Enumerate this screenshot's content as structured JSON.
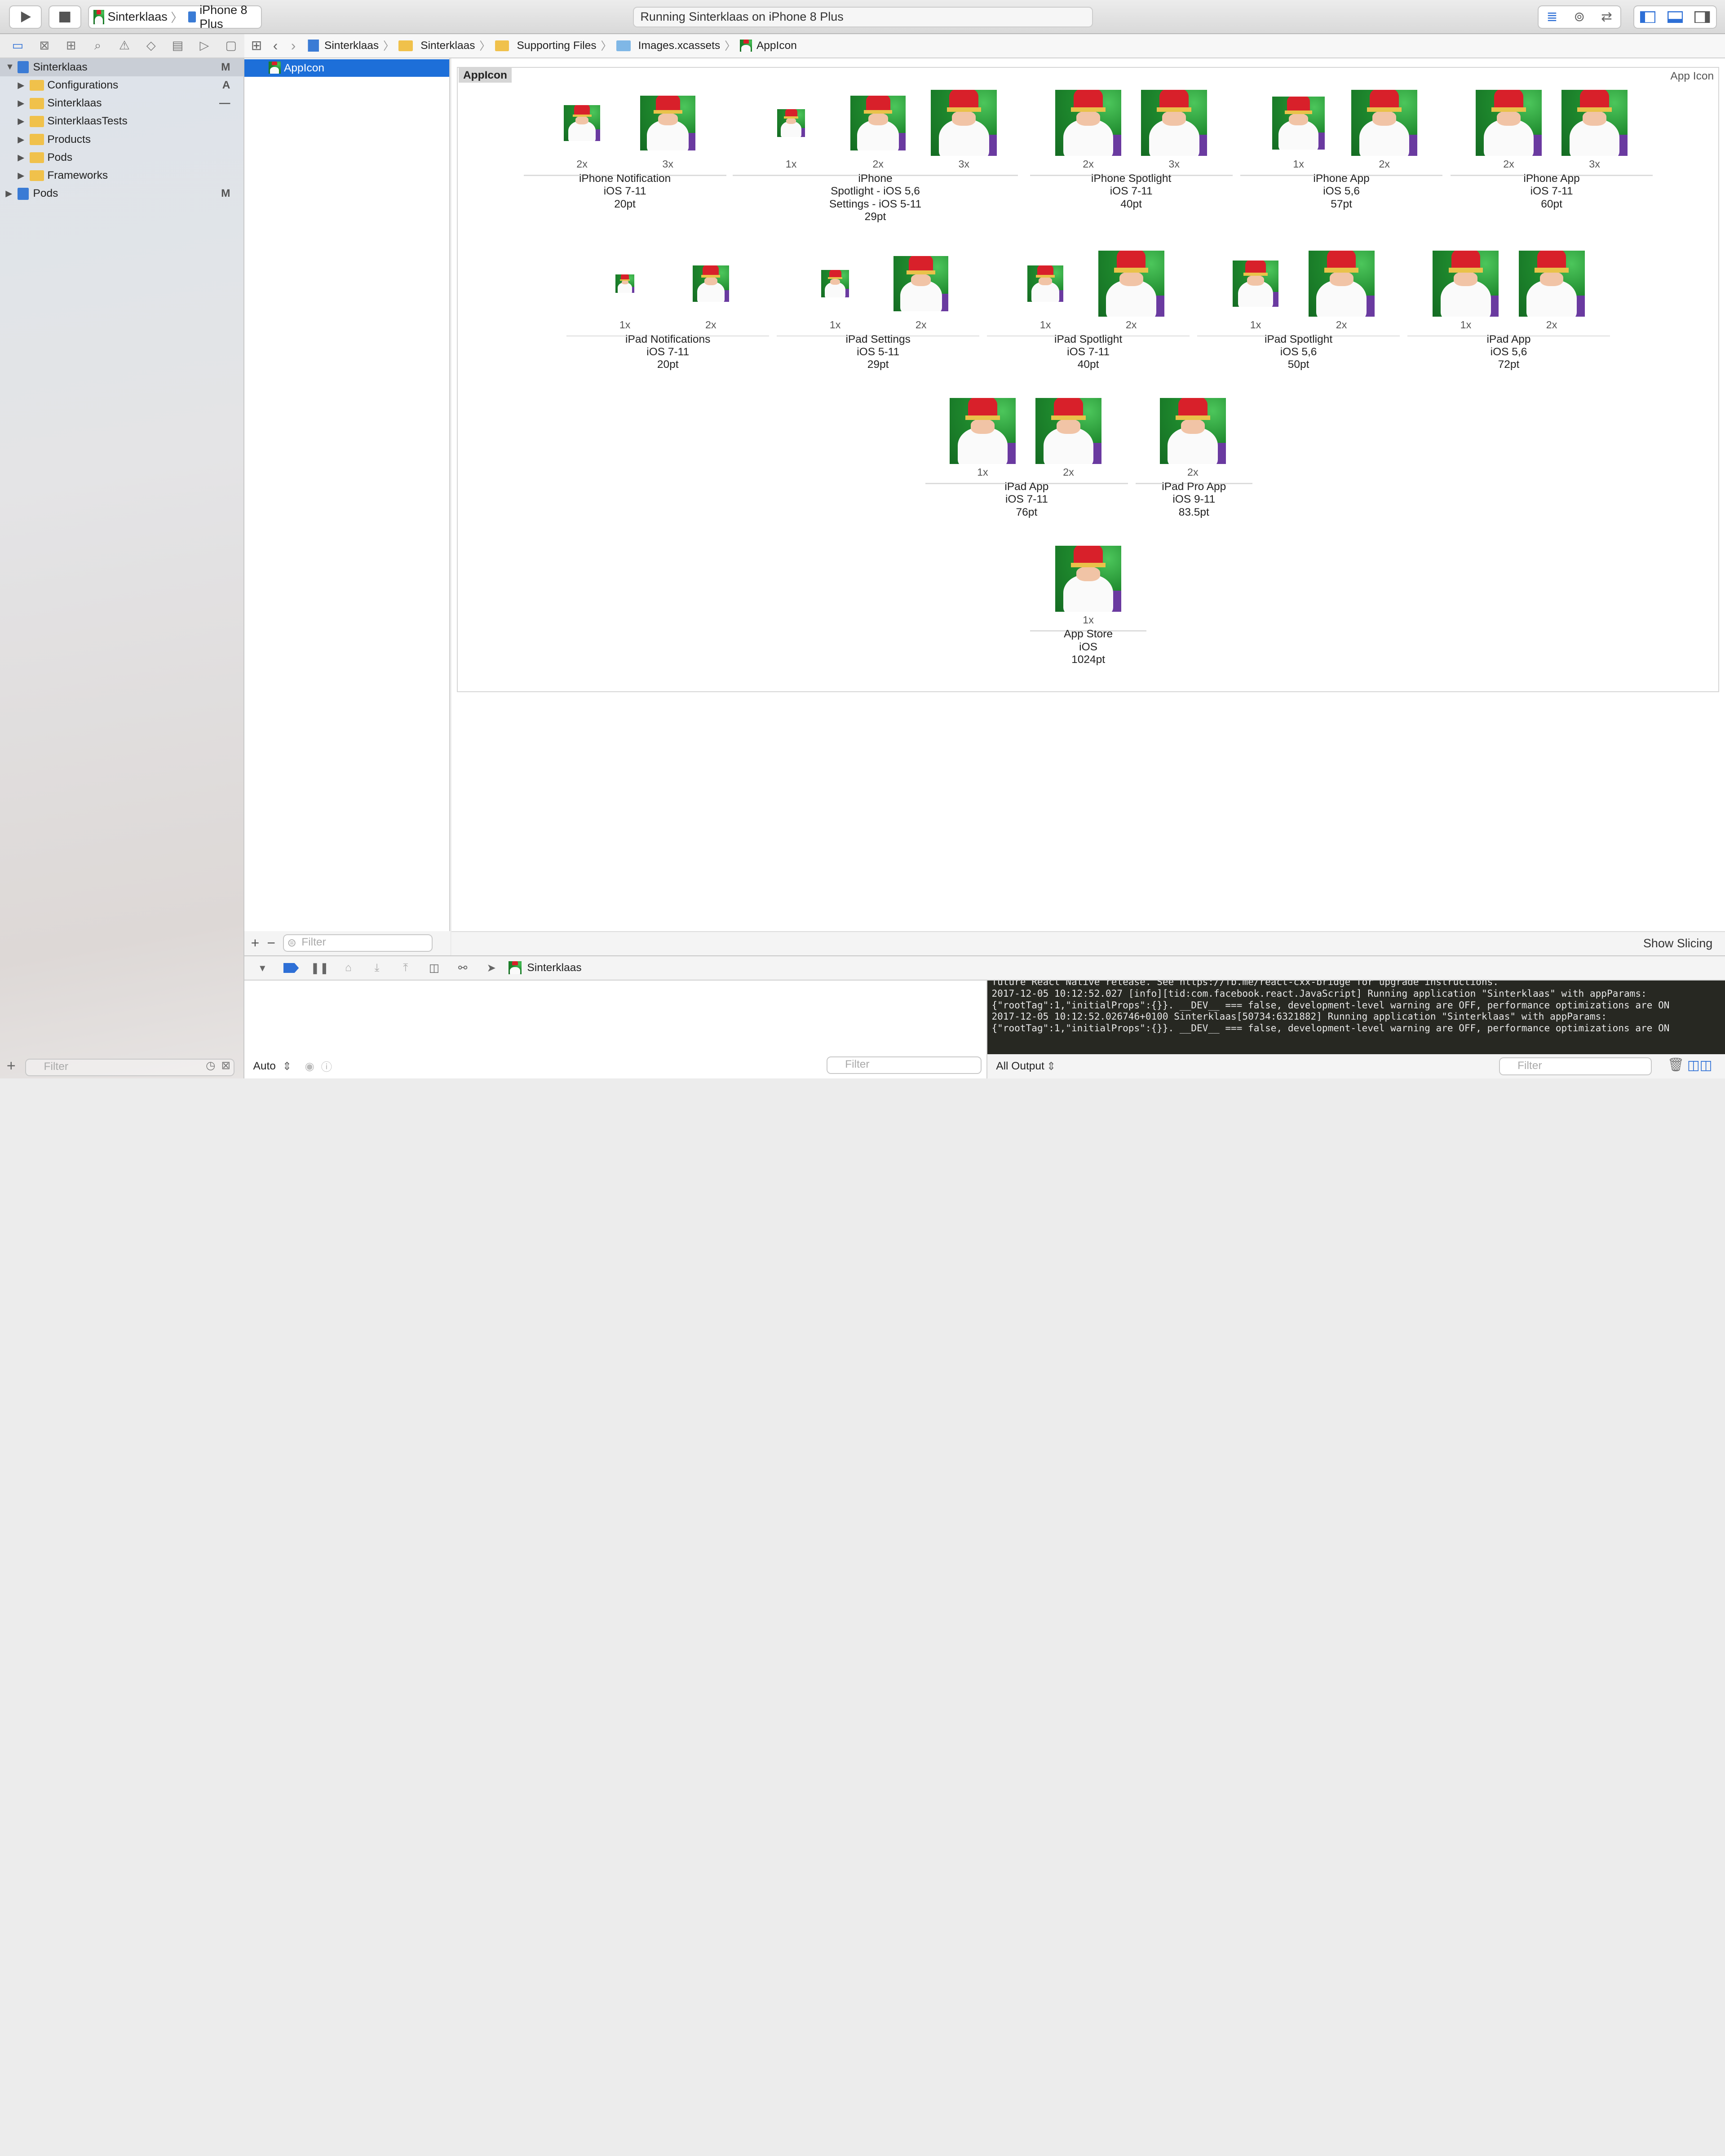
{
  "toolbar": {
    "scheme_app": "Sinterklaas",
    "scheme_device": "iPhone 8 Plus",
    "activity": "Running Sinterklaas on iPhone 8 Plus"
  },
  "navigator": {
    "items": [
      {
        "label": "Sinterklaas",
        "badge": "M"
      },
      {
        "label": "Configurations",
        "badge": "A"
      },
      {
        "label": "Sinterklaas",
        "badge": "—"
      },
      {
        "label": "SinterklaasTests",
        "badge": ""
      },
      {
        "label": "Products",
        "badge": ""
      },
      {
        "label": "Pods",
        "badge": ""
      },
      {
        "label": "Frameworks",
        "badge": ""
      },
      {
        "label": "Pods",
        "badge": "M"
      }
    ],
    "filter_placeholder": "Filter"
  },
  "jumpbar": {
    "crumbs": [
      "Sinterklaas",
      "Sinterklaas",
      "Supporting Files",
      "Images.xcassets",
      "AppIcon"
    ]
  },
  "set_list": {
    "selected": "AppIcon",
    "filter_placeholder": "Filter"
  },
  "asset": {
    "name": "AppIcon",
    "type": "App Icon",
    "groups": [
      {
        "line1": "iPhone Notification",
        "line2": "iOS 7-11",
        "line3": "20pt",
        "line4": "",
        "scales": [
          "2x",
          "3x"
        ]
      },
      {
        "line1": "iPhone",
        "line2": "Spotlight - iOS 5,6",
        "line3": "Settings - iOS 5-11",
        "line4": "29pt",
        "scales": [
          "1x",
          "2x",
          "3x"
        ]
      },
      {
        "line1": "iPhone Spotlight",
        "line2": "iOS 7-11",
        "line3": "40pt",
        "line4": "",
        "scales": [
          "2x",
          "3x"
        ]
      },
      {
        "line1": "iPhone App",
        "line2": "iOS 5,6",
        "line3": "57pt",
        "line4": "",
        "scales": [
          "1x",
          "2x"
        ]
      },
      {
        "line1": "iPhone App",
        "line2": "iOS 7-11",
        "line3": "60pt",
        "line4": "",
        "scales": [
          "2x",
          "3x"
        ]
      },
      {
        "line1": "iPad Notifications",
        "line2": "iOS 7-11",
        "line3": "20pt",
        "line4": "",
        "scales": [
          "1x",
          "2x"
        ]
      },
      {
        "line1": "iPad Settings",
        "line2": "iOS 5-11",
        "line3": "29pt",
        "line4": "",
        "scales": [
          "1x",
          "2x"
        ]
      },
      {
        "line1": "iPad Spotlight",
        "line2": "iOS 7-11",
        "line3": "40pt",
        "line4": "",
        "scales": [
          "1x",
          "2x"
        ]
      },
      {
        "line1": "iPad Spotlight",
        "line2": "iOS 5,6",
        "line3": "50pt",
        "line4": "",
        "scales": [
          "1x",
          "2x"
        ]
      },
      {
        "line1": "iPad App",
        "line2": "iOS 5,6",
        "line3": "72pt",
        "line4": "",
        "scales": [
          "1x",
          "2x"
        ]
      },
      {
        "line1": "iPad App",
        "line2": "iOS 7-11",
        "line3": "76pt",
        "line4": "",
        "scales": [
          "1x",
          "2x"
        ]
      },
      {
        "line1": "iPad Pro App",
        "line2": "iOS 9-11",
        "line3": "83.5pt",
        "line4": "",
        "scales": [
          "2x"
        ]
      },
      {
        "line1": "App Store",
        "line2": "iOS",
        "line3": "1024pt",
        "line4": "",
        "scales": [
          "1x"
        ]
      }
    ]
  },
  "editor_footer": {
    "show_slicing": "Show Slicing"
  },
  "debug_bar": {
    "target": "Sinterklaas"
  },
  "variables": {
    "mode": "Auto",
    "filter_placeholder": "Filter"
  },
  "console": {
    "lines": [
      "future React Native release. See https://fb.me/react-cxx-bridge for upgrade instructions.",
      "2017-12-05 10:12:52.027 [info][tid:com.facebook.react.JavaScript] Running application \"Sinterklaas\" with appParams:",
      "{\"rootTag\":1,\"initialProps\":{}}. __DEV__ === false, development-level warning are OFF, performance optimizations are ON",
      "2017-12-05 10:12:52.026746+0100 Sinterklaas[50734:6321882] Running application \"Sinterklaas\" with appParams:",
      "{\"rootTag\":1,\"initialProps\":{}}. __DEV__ === false, development-level warning are OFF, performance optimizations are ON"
    ],
    "output_mode": "All Output",
    "filter_placeholder": "Filter"
  },
  "colors": {
    "selection": "#1d6fd9",
    "console_bg": "#272822",
    "folder": "#f0c14b"
  }
}
